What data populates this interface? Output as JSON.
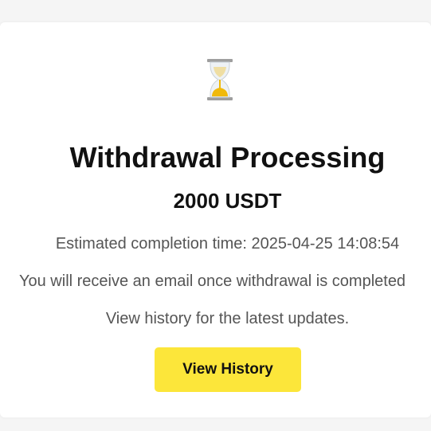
{
  "status_icon": "hourglass-icon",
  "title": "Withdrawal Processing",
  "amount": "2000 USDT",
  "estimated_completion": "Estimated completion time: 2025-04-25 14:08:54",
  "email_notice": "You will receive an email once withdrawal is completed",
  "history_hint": "View history for the latest updates.",
  "view_history_button": "View History",
  "colors": {
    "accent": "#fce63a",
    "hourglass_sand": "#f0b90b",
    "background": "#f5f5f5",
    "card": "#ffffff"
  }
}
